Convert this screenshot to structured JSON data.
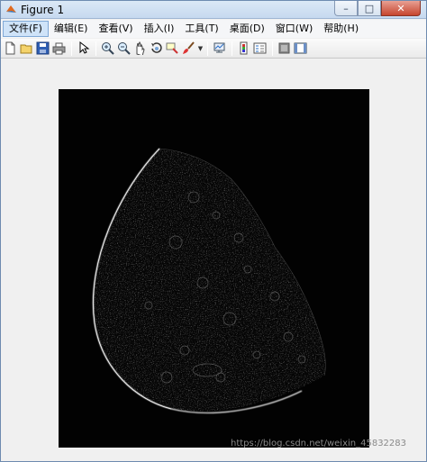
{
  "window": {
    "title": "Figure 1",
    "minimize_glyph": "–",
    "maximize_glyph": "□",
    "close_glyph": "✕"
  },
  "menu": {
    "items": [
      {
        "label": "文件(F)"
      },
      {
        "label": "编辑(E)"
      },
      {
        "label": "查看(V)"
      },
      {
        "label": "插入(I)"
      },
      {
        "label": "工具(T)"
      },
      {
        "label": "桌面(D)"
      },
      {
        "label": "窗口(W)"
      },
      {
        "label": "帮助(H)"
      }
    ]
  },
  "toolbar": {
    "icons": [
      "new-figure-icon",
      "open-file-icon",
      "save-icon",
      "print-icon",
      "pointer-icon",
      "zoom-in-icon",
      "zoom-out-icon",
      "pan-hand-icon",
      "rotate-3d-icon",
      "data-cursor-icon",
      "brush-icon",
      "link-plot-icon",
      "colorbar-icon",
      "legend-icon",
      "hide-plot-tools-icon",
      "show-plot-tools-icon"
    ]
  },
  "figure": {
    "image_description_colors": {
      "background": "#020202",
      "edge": "#d8d8d8"
    },
    "watermark": "https://blog.csdn.net/weixin_45832283"
  }
}
